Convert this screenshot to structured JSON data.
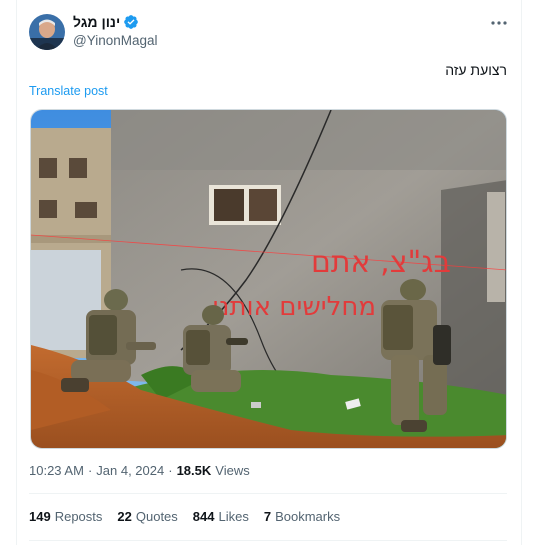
{
  "author": {
    "display_name": "ינון מגל",
    "handle": "@YinonMagal",
    "verified": true
  },
  "tweet": {
    "text": "רצועת עזה",
    "translate_label": "Translate post"
  },
  "image": {
    "graffiti_line1": "בג\"צ, אתם",
    "graffiti_line2": "מחלישים אותנו"
  },
  "meta": {
    "time": "10:23 AM",
    "separator": "·",
    "date": "Jan 4, 2024",
    "views_count": "18.5K",
    "views_label": "Views"
  },
  "stats": [
    {
      "count": "149",
      "label": "Reposts"
    },
    {
      "count": "22",
      "label": "Quotes"
    },
    {
      "count": "844",
      "label": "Likes"
    },
    {
      "count": "7",
      "label": "Bookmarks"
    }
  ],
  "colors": {
    "link": "#1d9bf0",
    "verified": "#1d9bf0",
    "secondary_text": "#536471",
    "graffiti": "#e23b3b"
  }
}
